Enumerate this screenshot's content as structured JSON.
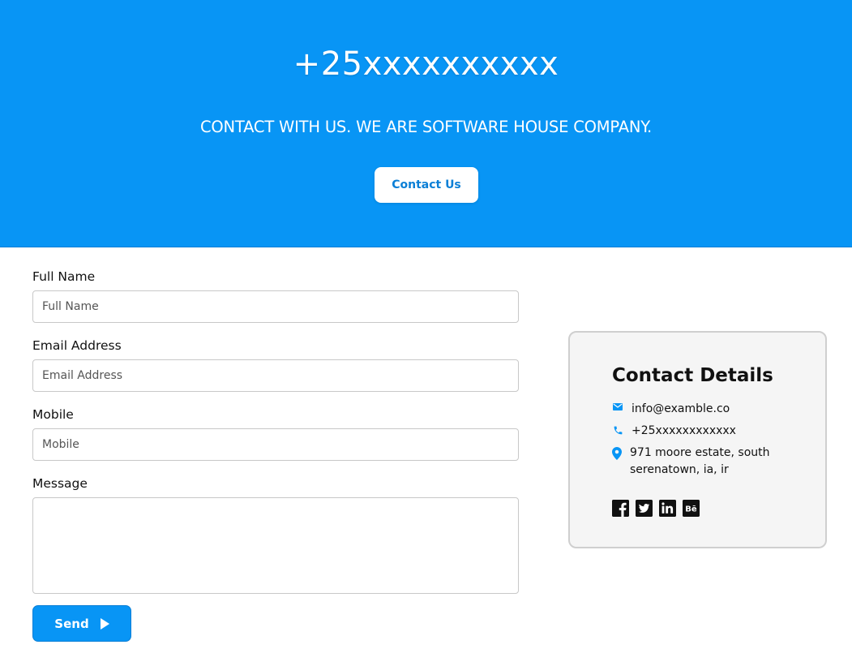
{
  "hero": {
    "phone": "+25xxxxxxxxxx",
    "tagline": "CONTACT WITH US. WE ARE SOFTWARE HOUSE COMPANY.",
    "contact_button": "Contact Us"
  },
  "form": {
    "full_name": {
      "label": "Full Name",
      "placeholder": "Full Name",
      "value": ""
    },
    "email": {
      "label": "Email Address",
      "placeholder": "Email Address",
      "value": ""
    },
    "mobile": {
      "label": "Mobile",
      "placeholder": "Mobile",
      "value": ""
    },
    "message": {
      "label": "Message",
      "value": ""
    },
    "send_label": "Send"
  },
  "contact_details": {
    "title": "Contact Details",
    "email": "info@examble.co",
    "phone": "+25xxxxxxxxxxxx",
    "address": "971 moore estate, south serenatown, ia, ir",
    "socials": [
      {
        "name": "facebook-icon"
      },
      {
        "name": "twitter-icon"
      },
      {
        "name": "linkedin-icon"
      },
      {
        "name": "behance-icon"
      }
    ]
  },
  "colors": {
    "accent": "#0895f5",
    "accent_dark": "#0b7fd6",
    "card_bg": "#f5f5f5"
  }
}
